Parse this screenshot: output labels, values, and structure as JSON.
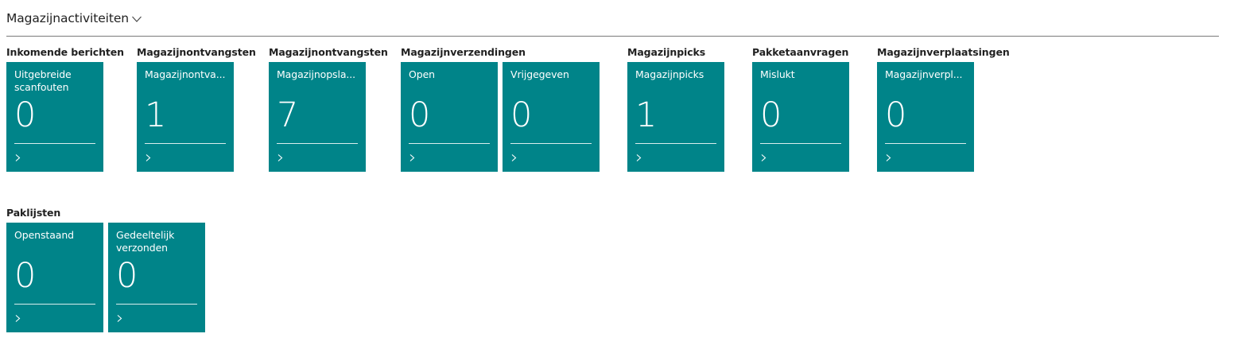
{
  "section": {
    "title": "Magazijnactiviteiten"
  },
  "colors": {
    "tile_bg": "#008489",
    "tile_text": "#FFFFFF",
    "divider": "#7A7A7A"
  },
  "groups": [
    {
      "title": "Inkomende berichten",
      "tiles": [
        {
          "label": "Uitgebreide scanfouten",
          "value": "0"
        }
      ]
    },
    {
      "title": "Magazijnontvangsten",
      "tiles": [
        {
          "label": "Magazijnontva...",
          "value": "1"
        }
      ]
    },
    {
      "title": "Magazijnontvangsten",
      "tiles": [
        {
          "label": "Magazijnopsla...",
          "value": "7"
        }
      ]
    },
    {
      "title": "Magazijnverzendingen",
      "tiles": [
        {
          "label": "Open",
          "value": "0"
        },
        {
          "label": "Vrijgegeven",
          "value": "0"
        }
      ]
    },
    {
      "title": "Magazijnpicks",
      "tiles": [
        {
          "label": "Magazijnpicks",
          "value": "1"
        }
      ]
    },
    {
      "title": "Pakketaanvragen",
      "tiles": [
        {
          "label": "Mislukt",
          "value": "0"
        }
      ]
    },
    {
      "title": "Magazijnverplaatsingen",
      "tiles": [
        {
          "label": "Magazijnverpl...",
          "value": "0"
        }
      ]
    },
    {
      "title": "Paklijsten",
      "tiles": [
        {
          "label": "Openstaand",
          "value": "0"
        },
        {
          "label": "Gedeeltelijk verzonden",
          "value": "0"
        }
      ]
    }
  ]
}
